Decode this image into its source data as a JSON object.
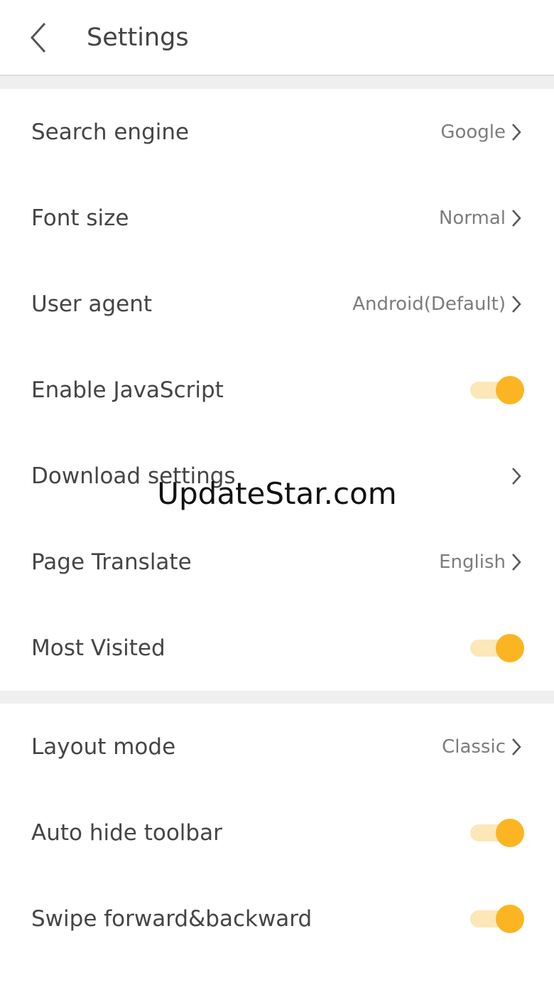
{
  "header": {
    "title": "Settings"
  },
  "section1": [
    {
      "label": "Search engine",
      "value": "Google",
      "kind": "nav"
    },
    {
      "label": "Font size",
      "value": "Normal",
      "kind": "nav"
    },
    {
      "label": "User agent",
      "value": "Android(Default)",
      "kind": "nav"
    },
    {
      "label": "Enable JavaScript",
      "on": true,
      "kind": "toggle"
    },
    {
      "label": "Download settings",
      "value": "",
      "kind": "nav"
    },
    {
      "label": "Page Translate",
      "value": "English",
      "kind": "nav"
    },
    {
      "label": "Most Visited",
      "on": true,
      "kind": "toggle"
    }
  ],
  "section2": [
    {
      "label": "Layout mode",
      "value": "Classic",
      "kind": "nav"
    },
    {
      "label": "Auto hide toolbar",
      "on": true,
      "kind": "toggle"
    },
    {
      "label": "Swipe forward&backward",
      "on": true,
      "kind": "toggle"
    }
  ],
  "watermark": "UpdateStar.com",
  "colors": {
    "accent": "#fbb522",
    "accent_light": "#fbe7b8",
    "divider": "#efefef"
  },
  "icons": {
    "back": "chevron-left-icon",
    "row_arrow": "chevron-right-icon"
  }
}
